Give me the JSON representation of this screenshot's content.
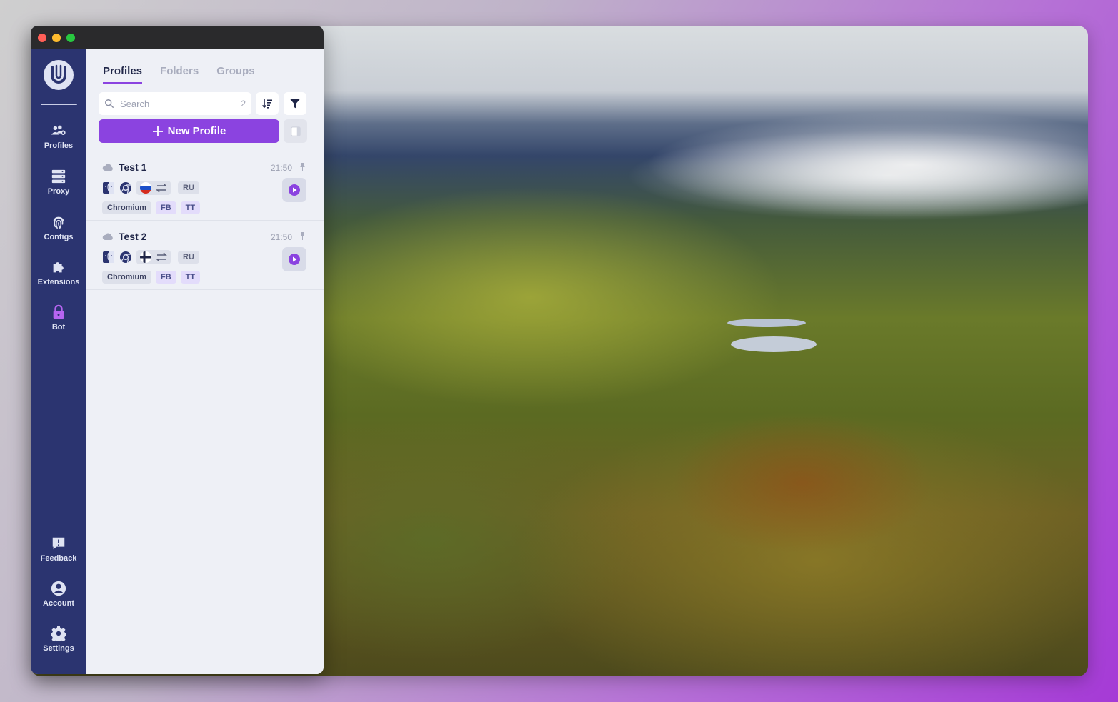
{
  "window": {
    "title": ""
  },
  "sidebar": {
    "items": [
      {
        "label": "Profiles",
        "icon": "users-gear-icon"
      },
      {
        "label": "Proxy",
        "icon": "server-icon"
      },
      {
        "label": "Configs",
        "icon": "fingerprint-icon"
      },
      {
        "label": "Extensions",
        "icon": "puzzle-icon"
      },
      {
        "label": "Bot",
        "icon": "lock-icon"
      }
    ],
    "bottom_items": [
      {
        "label": "Feedback",
        "icon": "feedback-icon"
      },
      {
        "label": "Account",
        "icon": "account-icon"
      },
      {
        "label": "Settings",
        "icon": "gear-icon"
      }
    ]
  },
  "tabs": [
    {
      "label": "Profiles",
      "active": true
    },
    {
      "label": "Folders",
      "active": false
    },
    {
      "label": "Groups",
      "active": false
    }
  ],
  "search": {
    "placeholder": "Search",
    "value": "",
    "count": "2"
  },
  "new_profile_label": "New Profile",
  "profiles": [
    {
      "name": "Test 1",
      "time": "21:50",
      "flag": "russia",
      "geo": "RU",
      "browser": "Chromium",
      "tags": [
        "FB",
        "TT"
      ]
    },
    {
      "name": "Test 2",
      "time": "21:50",
      "flag": "finland",
      "geo": "RU",
      "browser": "Chromium",
      "tags": [
        "FB",
        "TT"
      ]
    }
  ],
  "colors": {
    "accent": "#8b43e0",
    "sidebar": "#2b3470",
    "panel": "#eef0f6"
  }
}
